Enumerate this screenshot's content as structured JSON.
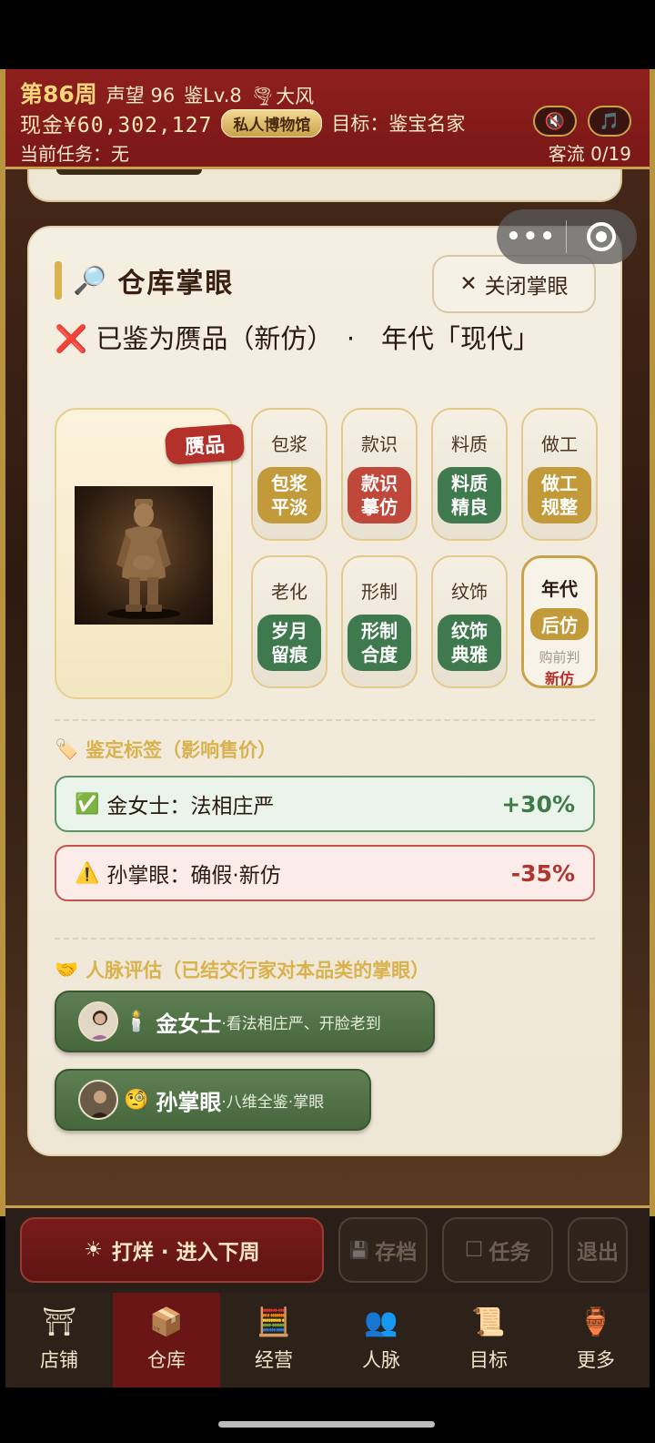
{
  "header": {
    "week": "第86周",
    "reputation": "声望 96",
    "level": "鉴Lv.8",
    "weather_icon": "tornado-icon",
    "weather": "大风",
    "cash": "现金¥60,302,127",
    "museum_badge": "私人博物馆",
    "goal": "目标：鉴宝名家",
    "task": "当前任务：无",
    "traffic": "客流 0/19",
    "sound_icon": "🔇",
    "music_icon": "🎵"
  },
  "capsule": {
    "dots": "•••"
  },
  "panel": {
    "title": "仓库掌眼",
    "close_label": "关闭掌眼",
    "close_icon": "✕",
    "verdict_icon": "❌",
    "verdict": "已鉴为赝品（新仿）　·　年代「现代」",
    "fake_tag": "赝品",
    "attributes": [
      {
        "name": "包浆",
        "value": "包浆\n平淡",
        "tone": "gold"
      },
      {
        "name": "款识",
        "value": "款识\n摹仿",
        "tone": "red"
      },
      {
        "name": "料质",
        "value": "料质\n精良",
        "tone": "green"
      },
      {
        "name": "做工",
        "value": "做工\n规整",
        "tone": "gold"
      },
      {
        "name": "老化",
        "value": "岁月\n留痕",
        "tone": "green"
      },
      {
        "name": "形制",
        "value": "形制\n合度",
        "tone": "green"
      },
      {
        "name": "纹饰",
        "value": "纹饰\n典雅",
        "tone": "green"
      }
    ],
    "era": {
      "name": "年代",
      "value": "后仿",
      "note": "购前判",
      "note2": "新仿"
    }
  },
  "tags": {
    "section_icon": "🏷️",
    "section_title": "鉴定标签（影响售价）",
    "items": [
      {
        "icon": "✅",
        "text": "金女士：法相庄严",
        "pct": "+30%"
      },
      {
        "icon": "⚠️",
        "text": "孙掌眼：确假·新仿",
        "pct": "-35%"
      }
    ]
  },
  "contacts": {
    "section_icon": "🤝",
    "section_title": "人脉评估（已结交行家对本品类的掌眼）",
    "items": [
      {
        "emoji": "🕯️",
        "name": "金女士",
        "desc": "·看法相庄严、开脸老到"
      },
      {
        "emoji": "🧐",
        "name": "孙掌眼",
        "desc": "·八维全鉴·掌眼"
      }
    ]
  },
  "actions": {
    "next_icon": "☀",
    "next": "打烊 · 进入下周",
    "save_icon": "💾",
    "save": "存档",
    "task_icon": "☐",
    "task": "任务",
    "quit": "退出"
  },
  "tabs": [
    {
      "icon": "⛩",
      "label": "店铺"
    },
    {
      "icon": "📦",
      "label": "仓库"
    },
    {
      "icon": "🧮",
      "label": "经营"
    },
    {
      "icon": "👥",
      "label": "人脉"
    },
    {
      "icon": "📜",
      "label": "目标"
    },
    {
      "icon": "🏺",
      "label": "更多"
    }
  ]
}
